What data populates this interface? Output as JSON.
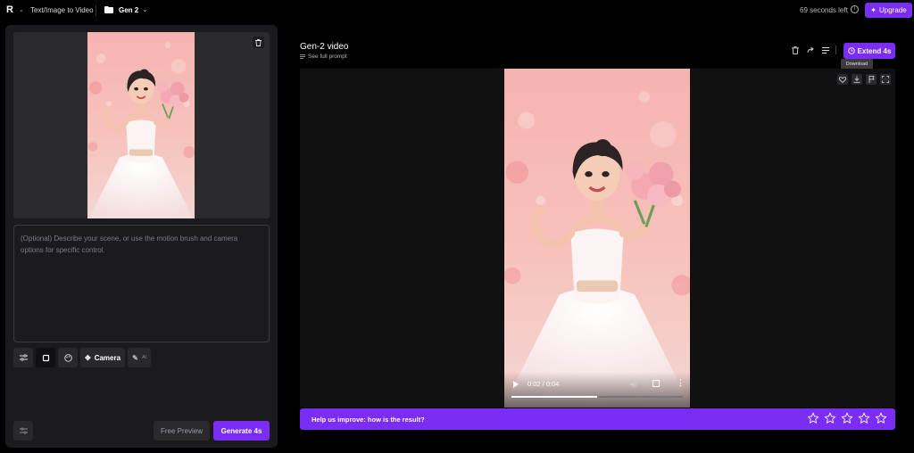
{
  "header": {
    "breadcrumb_mode": "Text/Image to Video",
    "folder_name": "Gen 2",
    "time_left": "69 seconds left",
    "upgrade_label": "Upgrade"
  },
  "left_panel": {
    "prompt_placeholder": "(Optional) Describe your scene, or use the motion brush and camera options for specific control.",
    "camera_label": "Camera",
    "free_preview_label": "Free Preview",
    "generate_label": "Generate 4s"
  },
  "output": {
    "title": "Gen-2 video",
    "see_full_prompt": "See full prompt",
    "extend_label": "Extend 4s",
    "tooltip": "Download",
    "player_time": "0:02 / 0:04",
    "progress": 0.5,
    "feedback_prompt": "Help us improve: how is the result?",
    "rating_stars": 5
  },
  "colors": {
    "accent": "#7b2cf5",
    "panel": "#1b1b1f",
    "background": "#000000"
  }
}
